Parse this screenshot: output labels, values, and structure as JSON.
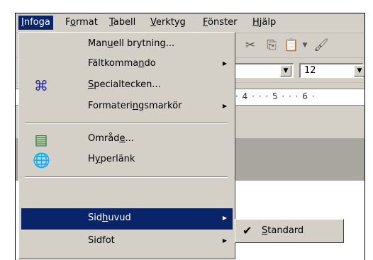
{
  "menubar": {
    "items": [
      {
        "label": "Infoga",
        "active": true
      },
      {
        "label": "Format"
      },
      {
        "label": "Tabell"
      },
      {
        "label": "Verktyg"
      },
      {
        "label": "Fönster"
      },
      {
        "label": "Hjälp"
      }
    ]
  },
  "toolbar": {
    "font_size_value": "12",
    "icons": [
      "cut-icon",
      "copy-icon",
      "paste-icon",
      "format-painter-icon"
    ]
  },
  "ruler": {
    "text": "· 4 · · · 5 · · · 6 ·"
  },
  "menu": {
    "items": [
      {
        "label": "Manuell brytning...",
        "icon": "",
        "submenu": false
      },
      {
        "label": "Fältkommando",
        "icon": "",
        "submenu": true
      },
      {
        "label": "Specialtecken...",
        "icon": "special-characters-icon",
        "submenu": false
      },
      {
        "label": "Formateringsmarkör",
        "icon": "",
        "submenu": true
      },
      {
        "label": "Område...",
        "icon": "section-icon",
        "submenu": false
      },
      {
        "label": "Hyperlänk",
        "icon": "hyperlink-icon",
        "submenu": false
      },
      {
        "label": "Sidhuvud",
        "icon": "",
        "submenu": true,
        "highlighted": true
      },
      {
        "label": "Sidfot",
        "icon": "",
        "submenu": true
      }
    ]
  },
  "submenu": {
    "items": [
      {
        "label": "Standard",
        "checked": true
      }
    ]
  },
  "colors": {
    "menu_bg": "#d4d0c8",
    "highlight": "#0a246a",
    "band": "#a9a6a0"
  }
}
